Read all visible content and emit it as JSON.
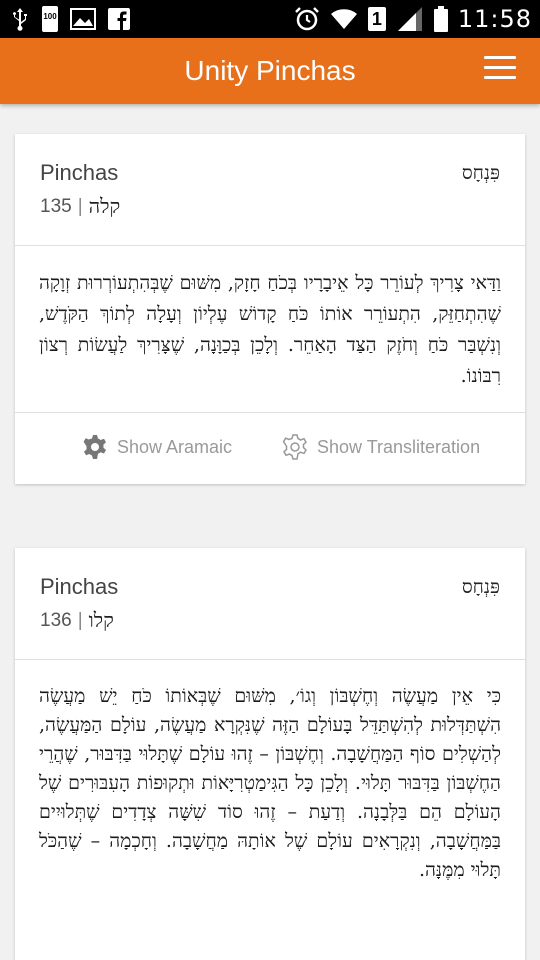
{
  "status_bar": {
    "time": "11:58",
    "battery": "100",
    "sim_slot": "1",
    "icons": [
      "usb-icon",
      "battery-icon",
      "image-icon",
      "facebook-icon",
      "alarm-icon",
      "wifi-icon",
      "signal-icon",
      "battery-full-icon"
    ]
  },
  "app_bar": {
    "title": "Unity Pinchas",
    "menu_icon": "hamburger-menu-icon",
    "color": "#e8701a"
  },
  "cards": [
    {
      "title": "Pinchas",
      "number": "135",
      "separator": "|",
      "hebrew_number": "קלה",
      "hebrew_title": "פִּנְחָס",
      "text": "וַדַּאי צָרִיךְ לְעוֹרֵר כָּל אֵיבָרָיו בְּכֹחַ חָזָק, מִשּׁוּם שֶׁבְּהִתְעוֹרְרוּת זְוָקָה שֶׁהִתְחַזֵּק, הִתְעוֹרֵר אוֹתוֹ כֹּחַ קָדוֹשׁ עֶלְיוֹן וְעָלָה לְתוֹךְ הַקֹּדֶשׁ, וְנִשְׁבַּר כֹּחַ וְחֹזֶק הַצַּד הָאַחֵר. וְלָכֵן בְּכַוָּנָה, שֶׁצָּרִיךְ לַעֲשׂוֹת רְצוֹן רִבּוֹנוֹ.",
      "show_aramaic": "Show Aramaic",
      "show_transliteration": "Show Transliteration"
    },
    {
      "title": "Pinchas",
      "number": "136",
      "separator": "|",
      "hebrew_number": "קלו",
      "hebrew_title": "פִּנְחָס",
      "text": "כִּי אֵין מַעֲשֶׂה וְחֶשְׁבּוֹן וְגוֹ׳, מִשּׁוּם שֶׁבְּאוֹתוֹ כֹּחַ יֵשׁ מַעֲשֶׂה הִשְׁתַּדְּלוּת לְהִשְׁתַּדֵּל בָּעוֹלָם הַזֶּה שֶׁנִּקְרָא מַעֲשֶׂה, עוֹלָם הַמַּעֲשֶׂה, לְהַשְׁלִים סוֹף הַמַּחֲשָׁבָה. וְחֶשְׁבּוֹן – זֶהוּ עוֹלָם שֶׁתָּלוּי בַּדִּבּוּר, שֶׁהֲרֵי הַחֶשְׁבּוֹן בַּדִּבּוּר תָּלוּי. וְלָכֵן כָּל הַגִּימַטְרִיָּאוֹת וּתְקוּפוֹת הָעִבּוּרִים שֶׁל הָעוֹלָם הֵם בַּלְּבָנָה. וְדַעַת – זֶהוּ סוֹד שִׁשָּׁה צְדָדִים שֶׁתְּלוּיִים בַּמַּחֲשָׁבָה, וְנִקְרָאִים עוֹלָם שֶׁל אוֹתָהּ מַחֲשָׁבָה. וְחָכְמָה – שֶׁהַכֹּל תָּלוּי מִמֶּנָּה."
    }
  ]
}
